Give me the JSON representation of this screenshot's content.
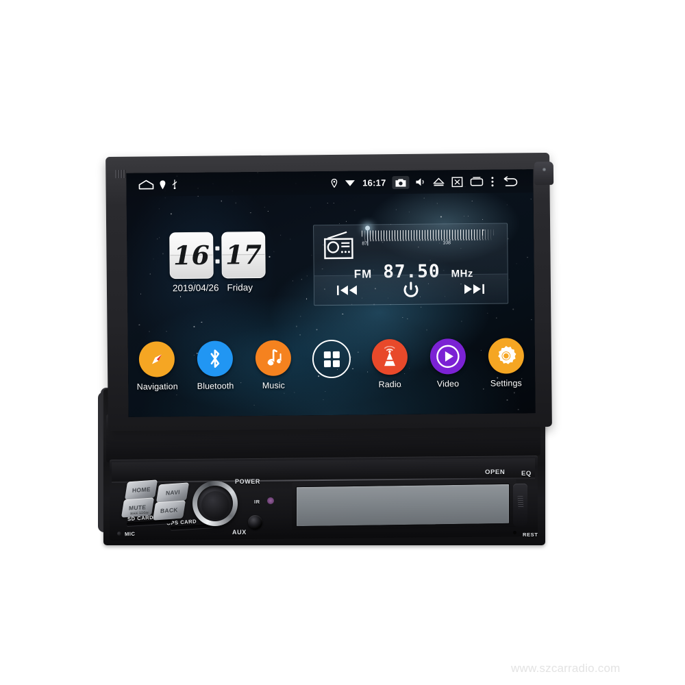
{
  "product": {
    "type": "1-din-retractable-android-car-stereo",
    "watermark": "www.szcarradio.com"
  },
  "screen": {
    "status_bar": {
      "left_icons": [
        {
          "name": "home-icon",
          "glyph": "home"
        },
        {
          "name": "location-pin-icon",
          "glyph": "pin"
        },
        {
          "name": "usb-icon",
          "glyph": "usb"
        }
      ],
      "time": "16:17",
      "right_icons": [
        {
          "name": "gps-pin-icon",
          "glyph": "pin"
        },
        {
          "name": "wifi-icon",
          "glyph": "wifi"
        },
        {
          "name": "camera-icon",
          "glyph": "camera",
          "highlighted": true
        },
        {
          "name": "volume-icon",
          "glyph": "speaker"
        },
        {
          "name": "eject-icon",
          "glyph": "eject"
        },
        {
          "name": "close-box-icon",
          "glyph": "close-box"
        },
        {
          "name": "recent-apps-icon",
          "glyph": "recents"
        },
        {
          "name": "overflow-menu-icon",
          "glyph": "kebab"
        },
        {
          "name": "back-icon",
          "glyph": "back-arrow"
        }
      ]
    },
    "clock_widget": {
      "hours": "16",
      "minutes": "17",
      "date": "2019/04/26",
      "weekday": "Friday"
    },
    "radio_widget": {
      "scale_min": "87",
      "scale_max": "108",
      "band": "FM",
      "frequency": "87.50",
      "unit": "MHz",
      "controls": [
        {
          "name": "previous-station-button",
          "glyph": "prev"
        },
        {
          "name": "radio-power-button",
          "glyph": "power"
        },
        {
          "name": "next-station-button",
          "glyph": "next"
        }
      ]
    },
    "dock": [
      {
        "id": "navigation",
        "label": "Navigation",
        "color": "#f5a623",
        "icon": "compass-icon"
      },
      {
        "id": "bluetooth",
        "label": "Bluetooth",
        "color": "#2196f3",
        "icon": "bluetooth-icon"
      },
      {
        "id": "music",
        "label": "Music",
        "color": "#f5821f",
        "icon": "music-note-icon"
      },
      {
        "id": "apps",
        "label": "",
        "color": "transparent",
        "icon": "app-drawer-icon"
      },
      {
        "id": "radio",
        "label": "Radio",
        "color": "#e8492a",
        "icon": "radio-tower-icon"
      },
      {
        "id": "video",
        "label": "Video",
        "color": "#7b22d4",
        "icon": "play-icon"
      },
      {
        "id": "settings",
        "label": "Settings",
        "color": "#f5a623",
        "icon": "gear-icon"
      }
    ]
  },
  "front_panel": {
    "buttons": [
      {
        "id": "home",
        "label": "HOME"
      },
      {
        "id": "navi",
        "label": "NAVI"
      },
      {
        "id": "mute",
        "label": "MUTE"
      },
      {
        "id": "back",
        "label": "BACK"
      }
    ],
    "open_label": "OPEN",
    "eq_label": "EQ",
    "power_label": "POWER",
    "aux_label": "AUX",
    "ir_label": "IR",
    "rest_label": "REST",
    "sd_card_label": "SD CARD",
    "gps_card_label": "GPS CARD",
    "mic_label": "MIC",
    "sd_voltage_label": "MAX 32GB"
  }
}
